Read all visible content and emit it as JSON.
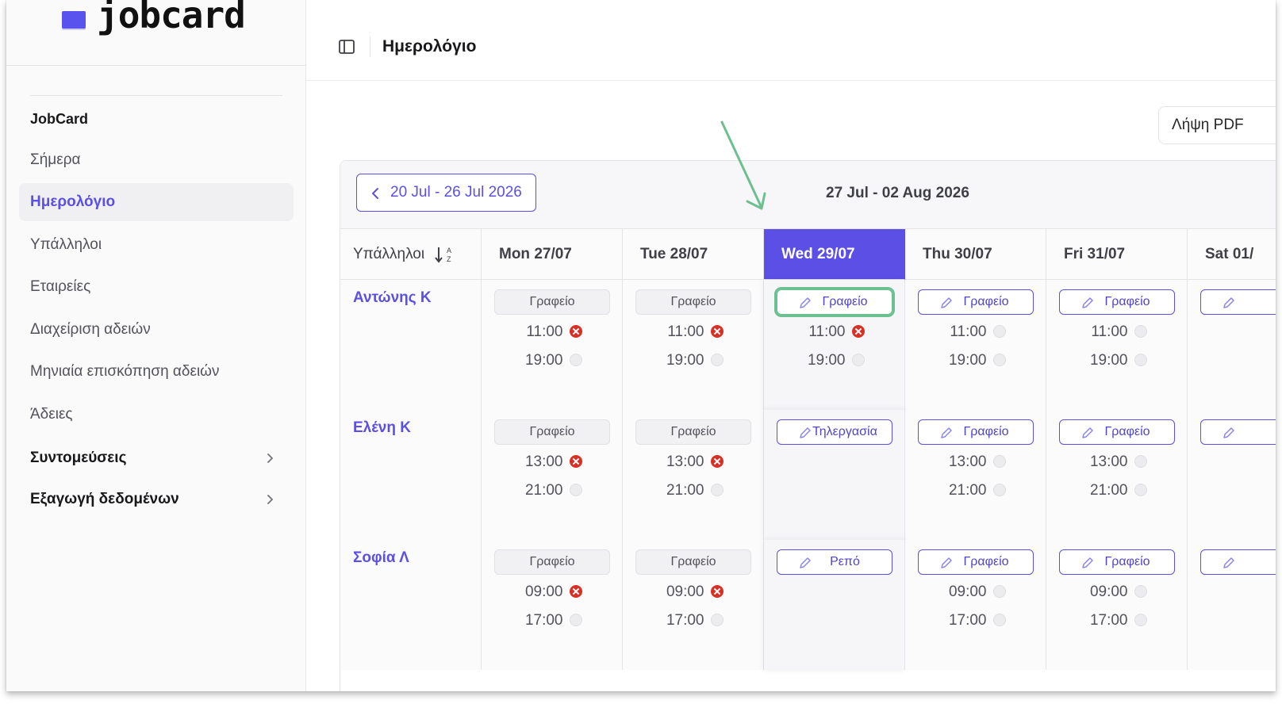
{
  "app": {
    "logo_text": "jobcard"
  },
  "sidebar": {
    "group_title": "JobCard",
    "items": [
      {
        "label": "Σήμερα",
        "active": false
      },
      {
        "label": "Ημερολόγιο",
        "active": true
      },
      {
        "label": "Υπάλληλοι",
        "active": false
      },
      {
        "label": "Εταιρείες",
        "active": false
      },
      {
        "label": "Διαχείριση αδειών",
        "active": false
      },
      {
        "label": "Μηνιαία επισκόπηση αδειών",
        "active": false
      },
      {
        "label": "Άδειες",
        "active": false
      }
    ],
    "sections": [
      {
        "label": "Συντομεύσεις"
      },
      {
        "label": "Εξαγωγή δεδομένων"
      }
    ]
  },
  "header": {
    "title": "Ημερολόγιο"
  },
  "toolbar": {
    "pdf_label": "Λήψη PDF"
  },
  "calendar": {
    "prev_week_label": "20 Jul - 26 Jul 2026",
    "current_week_label": "27 Jul - 02 Aug 2026",
    "employees_header": "Υπάλληλοι",
    "days": [
      {
        "label": "Mon 27/07",
        "today": false
      },
      {
        "label": "Tue 28/07",
        "today": false
      },
      {
        "label": "Wed 29/07",
        "today": true
      },
      {
        "label": "Thu 30/07",
        "today": false
      },
      {
        "label": "Fri 31/07",
        "today": false
      },
      {
        "label": "Sat 01/",
        "today": false
      }
    ],
    "rows": [
      {
        "employee": "Αντώνης Κ",
        "cells": [
          {
            "location": "Γραφείο",
            "editable": false,
            "start": "11:00",
            "start_status": "missed",
            "end": "19:00",
            "end_status": "pending"
          },
          {
            "location": "Γραφείο",
            "editable": false,
            "start": "11:00",
            "start_status": "missed",
            "end": "19:00",
            "end_status": "pending"
          },
          {
            "location": "Γραφείο",
            "editable": true,
            "highlight": true,
            "start": "11:00",
            "start_status": "missed",
            "end": "19:00",
            "end_status": "pending"
          },
          {
            "location": "Γραφείο",
            "editable": true,
            "start": "11:00",
            "start_status": "pending",
            "end": "19:00",
            "end_status": "pending"
          },
          {
            "location": "Γραφείο",
            "editable": true,
            "start": "11:00",
            "start_status": "pending",
            "end": "19:00",
            "end_status": "pending"
          },
          {
            "location": "",
            "editable": true
          }
        ]
      },
      {
        "employee": "Ελένη Κ",
        "cells": [
          {
            "location": "Γραφείο",
            "editable": false,
            "start": "13:00",
            "start_status": "missed",
            "end": "21:00",
            "end_status": "pending"
          },
          {
            "location": "Γραφείο",
            "editable": false,
            "start": "13:00",
            "start_status": "missed",
            "end": "21:00",
            "end_status": "pending"
          },
          {
            "location": "Τηλεργασία",
            "editable": true
          },
          {
            "location": "Γραφείο",
            "editable": true,
            "start": "13:00",
            "start_status": "pending",
            "end": "21:00",
            "end_status": "pending"
          },
          {
            "location": "Γραφείο",
            "editable": true,
            "start": "13:00",
            "start_status": "pending",
            "end": "21:00",
            "end_status": "pending"
          },
          {
            "location": "",
            "editable": true
          }
        ]
      },
      {
        "employee": "Σοφία Λ",
        "cells": [
          {
            "location": "Γραφείο",
            "editable": false,
            "start": "09:00",
            "start_status": "missed",
            "end": "17:00",
            "end_status": "pending"
          },
          {
            "location": "Γραφείο",
            "editable": false,
            "start": "09:00",
            "start_status": "missed",
            "end": "17:00",
            "end_status": "pending"
          },
          {
            "location": "Ρεπό",
            "editable": true
          },
          {
            "location": "Γραφείο",
            "editable": true,
            "start": "09:00",
            "start_status": "pending",
            "end": "17:00",
            "end_status": "pending"
          },
          {
            "location": "Γραφείο",
            "editable": true,
            "start": "09:00",
            "start_status": "pending",
            "end": "17:00",
            "end_status": "pending"
          },
          {
            "location": "",
            "editable": true
          }
        ]
      }
    ]
  },
  "colors": {
    "accent": "#5b4fe6",
    "missed": "#d93025",
    "highlight": "#6cc08f",
    "annotation_arrow": "#6cc08f"
  }
}
